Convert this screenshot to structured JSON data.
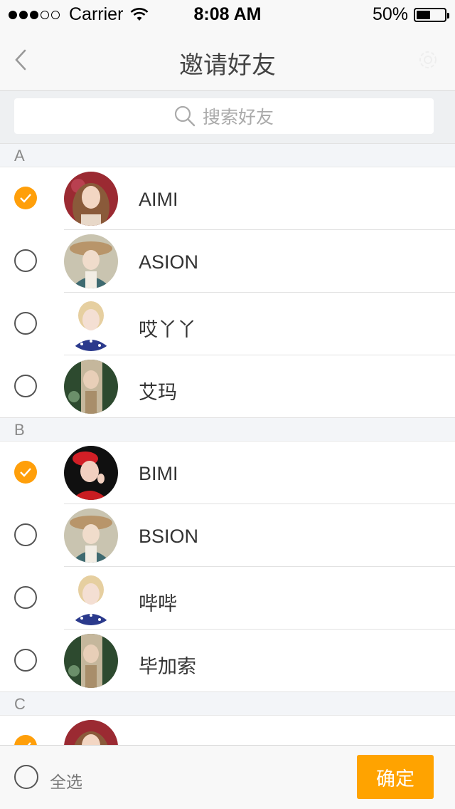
{
  "status_bar": {
    "carrier": "Carrier",
    "time": "8:08 AM",
    "battery_text": "50%",
    "battery_level": 0.5
  },
  "nav": {
    "title": "邀请好友",
    "back_icon": "chevron-left-icon",
    "settings_icon": "gear-icon"
  },
  "search": {
    "placeholder": "搜索好友",
    "icon": "search-icon"
  },
  "colors": {
    "accent": "#ffa300",
    "check_on": "#ff9f0a"
  },
  "sections": [
    {
      "letter": "A",
      "contacts": [
        {
          "name": "AIMI",
          "checked": true
        },
        {
          "name": "ASION",
          "checked": false
        },
        {
          "name": "哎丫丫",
          "checked": false
        },
        {
          "name": "艾玛",
          "checked": false
        }
      ]
    },
    {
      "letter": "B",
      "contacts": [
        {
          "name": "BIMI",
          "checked": true
        },
        {
          "name": "BSION",
          "checked": false
        },
        {
          "name": "哔哔",
          "checked": false
        },
        {
          "name": "毕加索",
          "checked": false
        }
      ]
    },
    {
      "letter": "C",
      "contacts": [
        {
          "name": "",
          "checked": true
        }
      ]
    }
  ],
  "bottom": {
    "select_all_label": "全选",
    "confirm_label": "确定"
  }
}
